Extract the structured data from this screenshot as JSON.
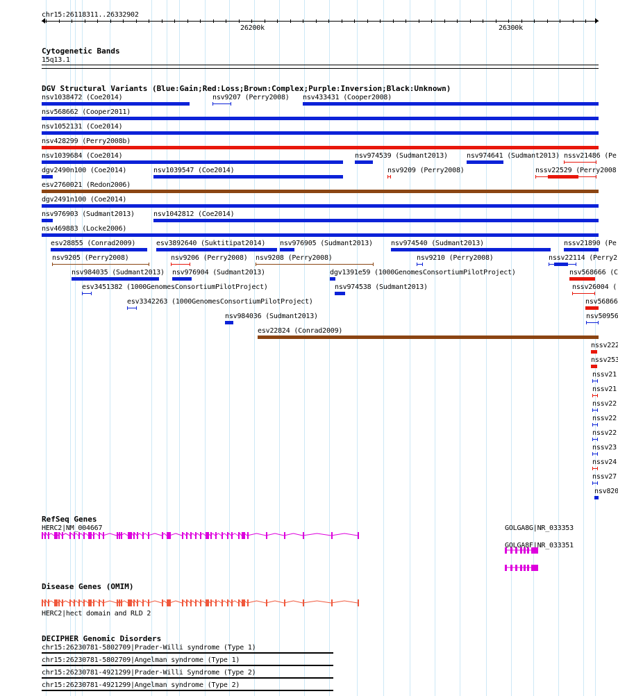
{
  "ruler": {
    "location": "chr15:26118311..26332902",
    "ticks": [
      "26200k",
      "26300k"
    ]
  },
  "cyto": {
    "title": "Cytogenetic Bands",
    "band": "15q13.1"
  },
  "dgv": {
    "title": "DGV Structural Variants (Blue:Gain;Red:Loss;Brown:Complex;Purple:Inversion;Black:Unknown)",
    "colors": {
      "gain": "#0c22d8",
      "loss": "#e8170b",
      "complex": "#8b4513"
    },
    "features": [
      {
        "label": "nsv1038472 (Coe2014)",
        "type": "gain"
      },
      {
        "label": "nsv9207 (Perry2008)",
        "type": "gain"
      },
      {
        "label": "nsv433431 (Cooper2008)",
        "type": "gain"
      },
      {
        "label": "nsv568662 (Cooper2011)",
        "type": "gain"
      },
      {
        "label": "nsv1052131 (Coe2014)",
        "type": "gain"
      },
      {
        "label": "nsv428299 (Perry2008b)",
        "type": "loss"
      },
      {
        "label": "nsv1039684 (Coe2014)",
        "type": "gain"
      },
      {
        "label": "nsv974539 (Sudmant2013)",
        "type": "gain"
      },
      {
        "label": "nsv974641 (Sudmant2013)",
        "type": "gain"
      },
      {
        "label": "nssv21486 (Pe",
        "type": "loss"
      },
      {
        "label": "dgv2490n100 (Coe2014)",
        "type": "gain"
      },
      {
        "label": "nsv1039547 (Coe2014)",
        "type": "gain"
      },
      {
        "label": "nsv9209 (Perry2008)",
        "type": "loss"
      },
      {
        "label": "nssv22529 (Perry2008",
        "type": "loss"
      },
      {
        "label": "esv2760021 (Redon2006)",
        "type": "complex"
      },
      {
        "label": "dgv2491n100 (Coe2014)",
        "type": "gain"
      },
      {
        "label": "nsv976903 (Sudmant2013)",
        "type": "gain"
      },
      {
        "label": "nsv1042812 (Coe2014)",
        "type": "gain"
      },
      {
        "label": "nsv469883 (Locke2006)",
        "type": "gain"
      },
      {
        "label": "esv28855 (Conrad2009)",
        "type": "gain"
      },
      {
        "label": "esv3892640 (Suktitipat2014)",
        "type": "gain"
      },
      {
        "label": "nsv976905 (Sudmant2013)",
        "type": "gain"
      },
      {
        "label": "nsv974540 (Sudmant2013)",
        "type": "gain"
      },
      {
        "label": "nssv21890 (Pe",
        "type": "gain"
      },
      {
        "label": "nsv9205 (Perry2008)",
        "type": "complex"
      },
      {
        "label": "nsv9206 (Perry2008)",
        "type": "loss"
      },
      {
        "label": "nsv9208 (Perry2008)",
        "type": "complex"
      },
      {
        "label": "nsv9210 (Perry2008)",
        "type": "gain"
      },
      {
        "label": "nssv22114 (Perry2",
        "type": "gain"
      },
      {
        "label": "nsv984035 (Sudmant2013)",
        "type": "gain"
      },
      {
        "label": "nsv976904 (Sudmant2013)",
        "type": "gain"
      },
      {
        "label": "dgv1391e59 (1000GenomesConsortiumPilotProject)",
        "type": "gain"
      },
      {
        "label": "nsv568666 (C",
        "type": "loss"
      },
      {
        "label": "esv3451382 (1000GenomesConsortiumPilotProject)",
        "type": "gain"
      },
      {
        "label": "nsv974538 (Sudmant2013)",
        "type": "gain"
      },
      {
        "label": "nssv26004 (",
        "type": "loss"
      },
      {
        "label": "esv3342263 (1000GenomesConsortiumPilotProject)",
        "type": "gain"
      },
      {
        "label": "nsv56866",
        "type": "loss"
      },
      {
        "label": "nsv984036 (Sudmant2013)",
        "type": "gain"
      },
      {
        "label": "nsv50956",
        "type": "gain"
      },
      {
        "label": "esv22824 (Conrad2009)",
        "type": "complex"
      },
      {
        "label": "nssv222",
        "type": "loss"
      },
      {
        "label": "nssv253",
        "type": "loss"
      },
      {
        "label": "nssv21",
        "type": "gain"
      },
      {
        "label": "nssv21",
        "type": "loss"
      },
      {
        "label": "nssv22",
        "type": "gain"
      },
      {
        "label": "nssv22",
        "type": "gain"
      },
      {
        "label": "nssv22",
        "type": "gain"
      },
      {
        "label": "nssv23",
        "type": "gain"
      },
      {
        "label": "nssv24",
        "type": "loss"
      },
      {
        "label": "nssv27",
        "type": "gain"
      },
      {
        "label": "nsv820",
        "type": "gain"
      }
    ]
  },
  "refseq": {
    "title": "RefSeq Genes",
    "color": "#dd00dd",
    "genes": [
      {
        "label": "HERC2|NM_004667"
      },
      {
        "label": "GOLGA8G|NR_033353"
      },
      {
        "label": "GOLGA8F|NR_033351"
      }
    ]
  },
  "omim": {
    "title": "Disease Genes (OMIM)",
    "color": "#f0583c",
    "gene_label": "HERC2|hect domain and RLD 2"
  },
  "decipher": {
    "title": "DECIPHER Genomic Disorders",
    "items": [
      {
        "label": "chr15:26230781-5802709|Prader-Willi syndrome (Type 1)"
      },
      {
        "label": "chr15:26230781-5802709|Angelman syndrome (Type 1)"
      },
      {
        "label": "chr15:26230781-4921299|Prader-Willi Syndrome (Type 2)"
      },
      {
        "label": "chr15:26230781-4921299|Angelman syndrome (Type 2)"
      }
    ]
  }
}
